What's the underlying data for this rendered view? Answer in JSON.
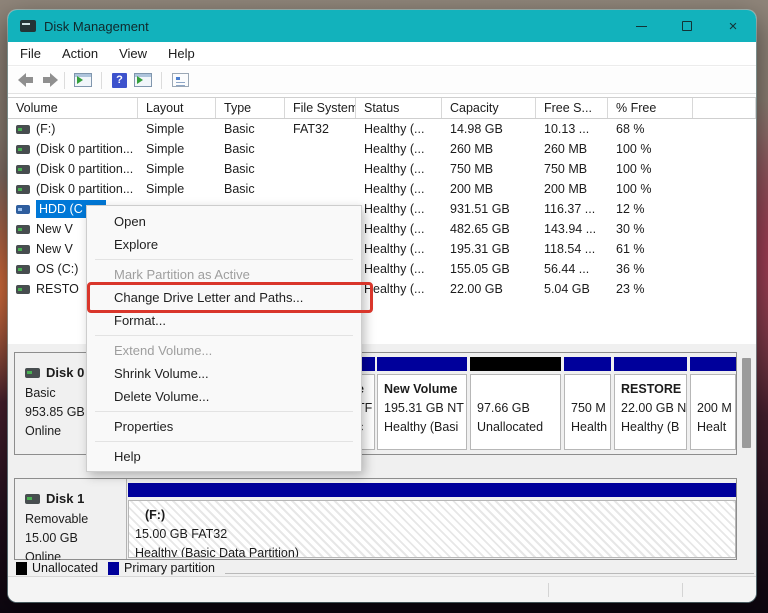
{
  "window": {
    "title": "Disk Management",
    "controls": [
      "minimize",
      "maximize",
      "close"
    ]
  },
  "colors": {
    "titlebar": "#12b2bc",
    "selection": "#0078d7",
    "primary_partition": "#00009b",
    "unallocated": "#000000",
    "annotation_red": "#d9362b"
  },
  "menu_bar": {
    "items": [
      "File",
      "Action",
      "View",
      "Help"
    ]
  },
  "toolbar": {
    "icons": [
      "back-arrow",
      "forward-arrow",
      "console-tree-icon",
      "help-icon",
      "action-window-icon",
      "properties-icon"
    ]
  },
  "volume_list": {
    "columns": [
      "Volume",
      "Layout",
      "Type",
      "File System",
      "Status",
      "Capacity",
      "Free S...",
      "% Free"
    ],
    "rows": [
      {
        "volume": "(F:)",
        "layout": "Simple",
        "type": "Basic",
        "fs": "FAT32",
        "status": "Healthy (...",
        "capacity": "14.98 GB",
        "free": "10.13 ...",
        "pct": "68 %"
      },
      {
        "volume": "(Disk 0 partition...",
        "layout": "Simple",
        "type": "Basic",
        "fs": "",
        "status": "Healthy (...",
        "capacity": "260 MB",
        "free": "260 MB",
        "pct": "100 %"
      },
      {
        "volume": "(Disk 0 partition...",
        "layout": "Simple",
        "type": "Basic",
        "fs": "",
        "status": "Healthy (...",
        "capacity": "750 MB",
        "free": "750 MB",
        "pct": "100 %"
      },
      {
        "volume": "(Disk 0 partition...",
        "layout": "Simple",
        "type": "Basic",
        "fs": "",
        "status": "Healthy (...",
        "capacity": "200 MB",
        "free": "200 MB",
        "pct": "100 %"
      },
      {
        "volume": "HDD (C",
        "layout": "",
        "type": "",
        "fs": "",
        "status": "Healthy (...",
        "capacity": "931.51 GB",
        "free": "116.37 ...",
        "pct": "12 %",
        "selected": true
      },
      {
        "volume": "New V",
        "layout": "",
        "type": "",
        "fs": "",
        "status": "Healthy (...",
        "capacity": "482.65 GB",
        "free": "143.94 ...",
        "pct": "30 %"
      },
      {
        "volume": "New V",
        "layout": "",
        "type": "",
        "fs": "",
        "status": "Healthy (...",
        "capacity": "195.31 GB",
        "free": "118.54 ...",
        "pct": "61 %"
      },
      {
        "volume": "OS (C:)",
        "layout": "",
        "type": "",
        "fs": "",
        "status": "Healthy (...",
        "capacity": "155.05 GB",
        "free": "56.44 ...",
        "pct": "36 %"
      },
      {
        "volume": "RESTO",
        "layout": "",
        "type": "",
        "fs": "",
        "status": "Healthy (...",
        "capacity": "22.00 GB",
        "free": "5.04 GB",
        "pct": "23 %"
      }
    ]
  },
  "context_menu": {
    "items": [
      {
        "label": "Open",
        "enabled": true
      },
      {
        "label": "Explore",
        "enabled": true
      },
      {
        "label": "Mark Partition as Active",
        "enabled": false
      },
      {
        "label": "Change Drive Letter and Paths...",
        "enabled": true,
        "annotated": true
      },
      {
        "label": "Format...",
        "enabled": true
      },
      {
        "label": "Extend Volume...",
        "enabled": false
      },
      {
        "label": "Shrink Volume...",
        "enabled": true
      },
      {
        "label": "Delete Volume...",
        "enabled": true
      },
      {
        "label": "Properties",
        "enabled": true
      },
      {
        "label": "Help",
        "enabled": true
      }
    ],
    "annotation_target": "Change Drive Letter and Paths..."
  },
  "disk_view": {
    "disk0": {
      "label": {
        "name": "Disk 0",
        "type": "Basic",
        "size": "953.85 GB",
        "status": "Online"
      },
      "partitions": [
        {
          "line1": "e",
          "line2": "TF",
          "line3": "c",
          "kind": "primary"
        },
        {
          "line1": "New Volume",
          "line2": "195.31 GB NT",
          "line3": "Healthy (Basi",
          "kind": "primary"
        },
        {
          "line1": "",
          "line2": "97.66 GB",
          "line3": "Unallocated",
          "kind": "unallocated"
        },
        {
          "line1": "",
          "line2": "750 M",
          "line3": "Health",
          "kind": "primary"
        },
        {
          "line1": "RESTORE",
          "line2": "22.00 GB N",
          "line3": "Healthy (B",
          "kind": "primary"
        },
        {
          "line1": "",
          "line2": "200 M",
          "line3": "Healt",
          "kind": "primary"
        }
      ]
    },
    "disk1": {
      "label": {
        "name": "Disk 1",
        "type": "Removable",
        "size": "15.00 GB",
        "status": "Online"
      },
      "partition": {
        "line1": "(F:)",
        "line2": "15.00 GB FAT32",
        "line3": "Healthy (Basic Data Partition)",
        "kind": "primary-selected"
      }
    }
  },
  "legend": {
    "items": [
      {
        "label": "Unallocated",
        "color": "#000000"
      },
      {
        "label": "Primary partition",
        "color": "#00009b"
      }
    ]
  }
}
